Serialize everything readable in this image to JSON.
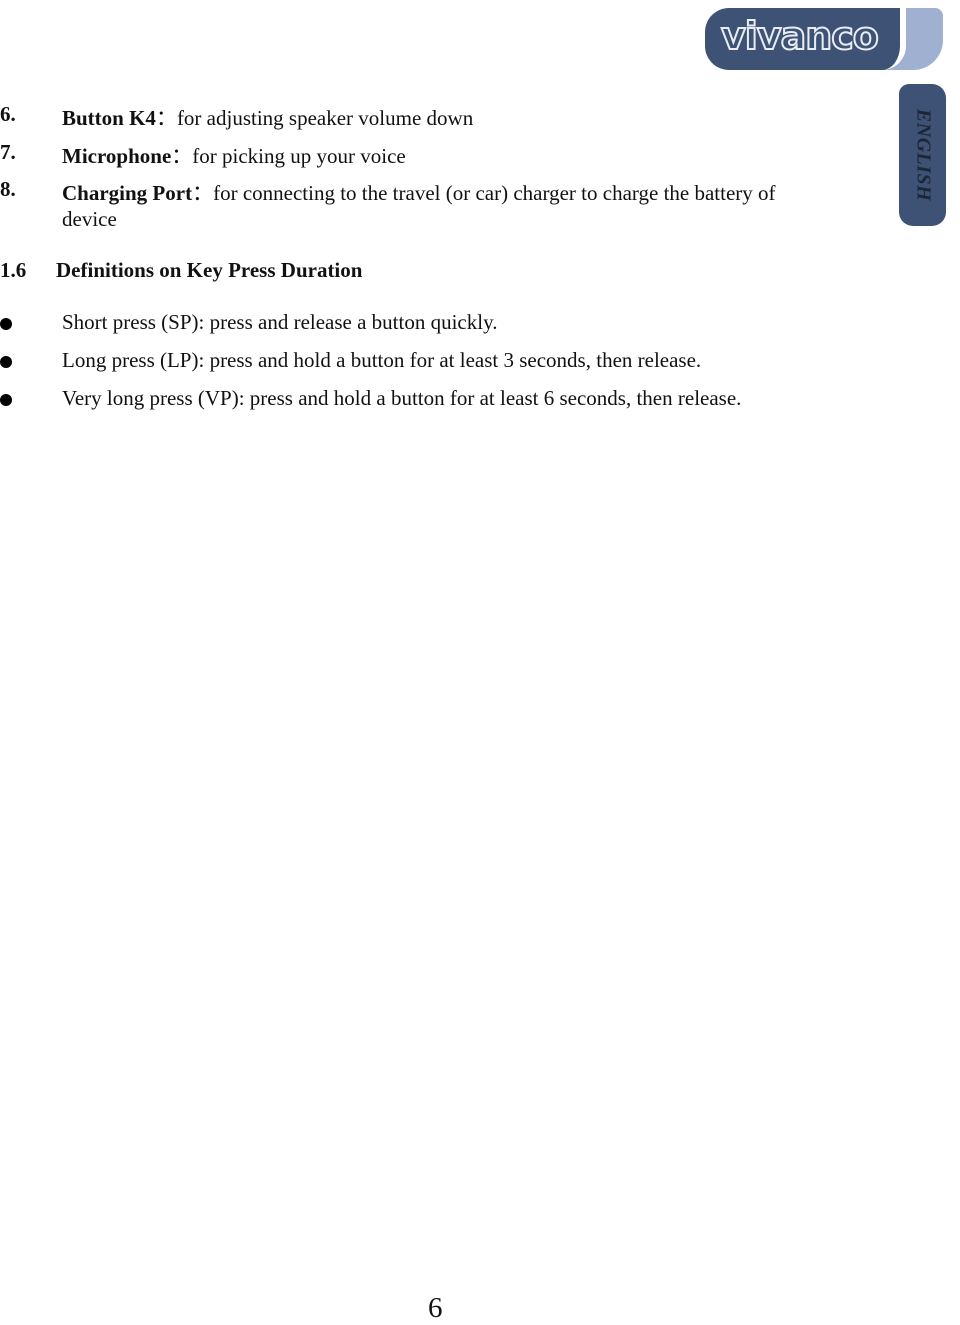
{
  "brand": {
    "logo_text": "vivanco",
    "language_tab": "ENGLISH",
    "colors": {
      "dark": "#3d5275",
      "light": "#9fb0d0"
    }
  },
  "items": [
    {
      "number": "6.",
      "term": "Button K4",
      "separator": "：",
      "description": "for adjusting speaker volume down"
    },
    {
      "number": "7.",
      "term": "Microphone",
      "separator": "：",
      "description": "for picking up your voice"
    },
    {
      "number": "8.",
      "term": "Charging Port",
      "separator": "：",
      "description": "for connecting to the travel (or car) charger to charge the battery of",
      "continuation": "device"
    }
  ],
  "section": {
    "number": "1.6",
    "title": "Definitions on Key Press Duration"
  },
  "bullets": [
    "Short press (SP): press and release a button quickly.",
    "Long press (LP): press and hold a button for at least 3 seconds, then release.",
    "Very long press (VP): press and hold a button for at least 6 seconds, then release."
  ],
  "page_number": "6"
}
